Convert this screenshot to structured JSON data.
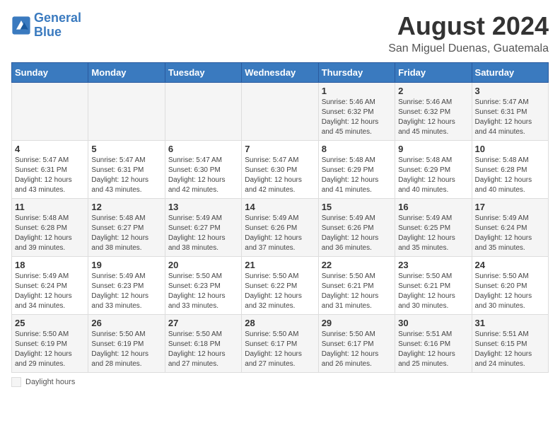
{
  "logo": {
    "line1": "General",
    "line2": "Blue"
  },
  "title": "August 2024",
  "subtitle": "San Miguel Duenas, Guatemala",
  "days_of_week": [
    "Sunday",
    "Monday",
    "Tuesday",
    "Wednesday",
    "Thursday",
    "Friday",
    "Saturday"
  ],
  "footnote_label": "Daylight hours",
  "weeks": [
    [
      {
        "day": "",
        "info": ""
      },
      {
        "day": "",
        "info": ""
      },
      {
        "day": "",
        "info": ""
      },
      {
        "day": "",
        "info": ""
      },
      {
        "day": "1",
        "info": "Sunrise: 5:46 AM\nSunset: 6:32 PM\nDaylight: 12 hours\nand 45 minutes."
      },
      {
        "day": "2",
        "info": "Sunrise: 5:46 AM\nSunset: 6:32 PM\nDaylight: 12 hours\nand 45 minutes."
      },
      {
        "day": "3",
        "info": "Sunrise: 5:47 AM\nSunset: 6:31 PM\nDaylight: 12 hours\nand 44 minutes."
      }
    ],
    [
      {
        "day": "4",
        "info": "Sunrise: 5:47 AM\nSunset: 6:31 PM\nDaylight: 12 hours\nand 43 minutes."
      },
      {
        "day": "5",
        "info": "Sunrise: 5:47 AM\nSunset: 6:31 PM\nDaylight: 12 hours\nand 43 minutes."
      },
      {
        "day": "6",
        "info": "Sunrise: 5:47 AM\nSunset: 6:30 PM\nDaylight: 12 hours\nand 42 minutes."
      },
      {
        "day": "7",
        "info": "Sunrise: 5:47 AM\nSunset: 6:30 PM\nDaylight: 12 hours\nand 42 minutes."
      },
      {
        "day": "8",
        "info": "Sunrise: 5:48 AM\nSunset: 6:29 PM\nDaylight: 12 hours\nand 41 minutes."
      },
      {
        "day": "9",
        "info": "Sunrise: 5:48 AM\nSunset: 6:29 PM\nDaylight: 12 hours\nand 40 minutes."
      },
      {
        "day": "10",
        "info": "Sunrise: 5:48 AM\nSunset: 6:28 PM\nDaylight: 12 hours\nand 40 minutes."
      }
    ],
    [
      {
        "day": "11",
        "info": "Sunrise: 5:48 AM\nSunset: 6:28 PM\nDaylight: 12 hours\nand 39 minutes."
      },
      {
        "day": "12",
        "info": "Sunrise: 5:48 AM\nSunset: 6:27 PM\nDaylight: 12 hours\nand 38 minutes."
      },
      {
        "day": "13",
        "info": "Sunrise: 5:49 AM\nSunset: 6:27 PM\nDaylight: 12 hours\nand 38 minutes."
      },
      {
        "day": "14",
        "info": "Sunrise: 5:49 AM\nSunset: 6:26 PM\nDaylight: 12 hours\nand 37 minutes."
      },
      {
        "day": "15",
        "info": "Sunrise: 5:49 AM\nSunset: 6:26 PM\nDaylight: 12 hours\nand 36 minutes."
      },
      {
        "day": "16",
        "info": "Sunrise: 5:49 AM\nSunset: 6:25 PM\nDaylight: 12 hours\nand 35 minutes."
      },
      {
        "day": "17",
        "info": "Sunrise: 5:49 AM\nSunset: 6:24 PM\nDaylight: 12 hours\nand 35 minutes."
      }
    ],
    [
      {
        "day": "18",
        "info": "Sunrise: 5:49 AM\nSunset: 6:24 PM\nDaylight: 12 hours\nand 34 minutes."
      },
      {
        "day": "19",
        "info": "Sunrise: 5:49 AM\nSunset: 6:23 PM\nDaylight: 12 hours\nand 33 minutes."
      },
      {
        "day": "20",
        "info": "Sunrise: 5:50 AM\nSunset: 6:23 PM\nDaylight: 12 hours\nand 33 minutes."
      },
      {
        "day": "21",
        "info": "Sunrise: 5:50 AM\nSunset: 6:22 PM\nDaylight: 12 hours\nand 32 minutes."
      },
      {
        "day": "22",
        "info": "Sunrise: 5:50 AM\nSunset: 6:21 PM\nDaylight: 12 hours\nand 31 minutes."
      },
      {
        "day": "23",
        "info": "Sunrise: 5:50 AM\nSunset: 6:21 PM\nDaylight: 12 hours\nand 30 minutes."
      },
      {
        "day": "24",
        "info": "Sunrise: 5:50 AM\nSunset: 6:20 PM\nDaylight: 12 hours\nand 30 minutes."
      }
    ],
    [
      {
        "day": "25",
        "info": "Sunrise: 5:50 AM\nSunset: 6:19 PM\nDaylight: 12 hours\nand 29 minutes."
      },
      {
        "day": "26",
        "info": "Sunrise: 5:50 AM\nSunset: 6:19 PM\nDaylight: 12 hours\nand 28 minutes."
      },
      {
        "day": "27",
        "info": "Sunrise: 5:50 AM\nSunset: 6:18 PM\nDaylight: 12 hours\nand 27 minutes."
      },
      {
        "day": "28",
        "info": "Sunrise: 5:50 AM\nSunset: 6:17 PM\nDaylight: 12 hours\nand 27 minutes."
      },
      {
        "day": "29",
        "info": "Sunrise: 5:50 AM\nSunset: 6:17 PM\nDaylight: 12 hours\nand 26 minutes."
      },
      {
        "day": "30",
        "info": "Sunrise: 5:51 AM\nSunset: 6:16 PM\nDaylight: 12 hours\nand 25 minutes."
      },
      {
        "day": "31",
        "info": "Sunrise: 5:51 AM\nSunset: 6:15 PM\nDaylight: 12 hours\nand 24 minutes."
      }
    ]
  ]
}
